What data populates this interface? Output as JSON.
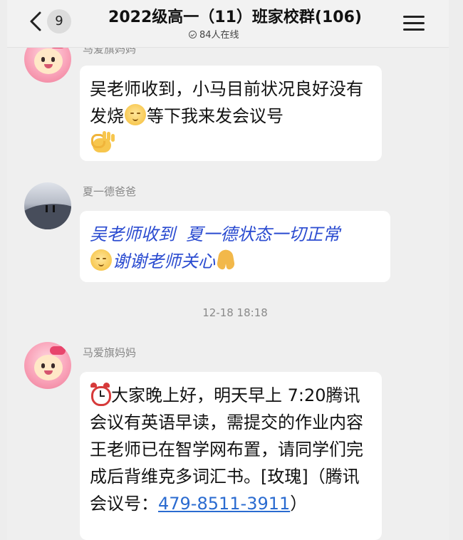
{
  "header": {
    "back_count": "9",
    "title": "2022级高一（11）班家校群(106)",
    "online": "84人在线",
    "icons": [
      "back-chevron-icon",
      "menu-icon",
      "online-status-icon"
    ]
  },
  "messages": [
    {
      "sender": "马爱旗妈妈",
      "text_1": "吴老师收到，小马目前状况良好没有发烧",
      "text_2": "等下我来发会议号"
    },
    {
      "sender": "夏一德爸爸",
      "text_1": "吴老师收到  夏一德状态一切正常",
      "text_2": "谢谢老师关心"
    },
    {
      "sender": "马爱旗妈妈",
      "text_1": "大家晚上好，明天早上 7:20腾讯会议有英语早读，需提交的作业内容王老师已在智学网布置，请同学们完成后背维克多词汇书。[玫瑰]（腾讯会议号：",
      "link": "479-8511-3911",
      "text_2": "）"
    }
  ],
  "timestamp": "12-18 18:18",
  "colors": {
    "link": "#2a6bd0",
    "blue_text": "#2a4bd0",
    "bubble": "#ffffff",
    "background": "#efefef"
  }
}
